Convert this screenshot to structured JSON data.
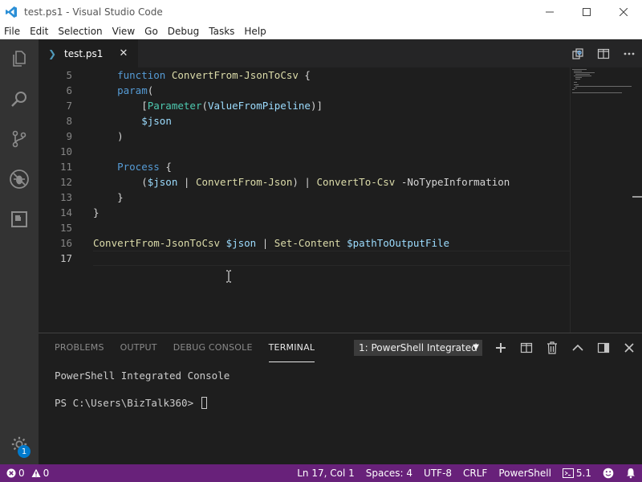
{
  "window": {
    "title": "test.ps1 - Visual Studio Code",
    "minimize": "—",
    "maximize": "☐",
    "close": "✕"
  },
  "menu": [
    "File",
    "Edit",
    "Selection",
    "View",
    "Go",
    "Debug",
    "Tasks",
    "Help"
  ],
  "tab": {
    "label": "test.ps1",
    "icon_text": "❯",
    "close": "✕"
  },
  "editor": {
    "line_numbers": [
      "5",
      "6",
      "7",
      "8",
      "9",
      "10",
      "11",
      "12",
      "13",
      "14",
      "15",
      "16",
      "17"
    ],
    "active_line": "17"
  },
  "panel": {
    "tabs": [
      "PROBLEMS",
      "OUTPUT",
      "DEBUG CONSOLE",
      "TERMINAL"
    ],
    "active_tab": "TERMINAL",
    "terminal_select": "1: PowerShell Integrated",
    "terminal_lines": [
      "PowerShell Integrated Console",
      "",
      "PS C:\\Users\\BizTalk360> "
    ]
  },
  "activity": {
    "badge": "1"
  },
  "status": {
    "errors": "0",
    "warnings": "0",
    "position": "Ln 17, Col 1",
    "spaces": "Spaces: 4",
    "encoding": "UTF-8",
    "eol": "CRLF",
    "language": "PowerShell",
    "ps_version": "5.1"
  },
  "colors": {
    "statusbar": "#68217a",
    "accent": "#007acc"
  }
}
